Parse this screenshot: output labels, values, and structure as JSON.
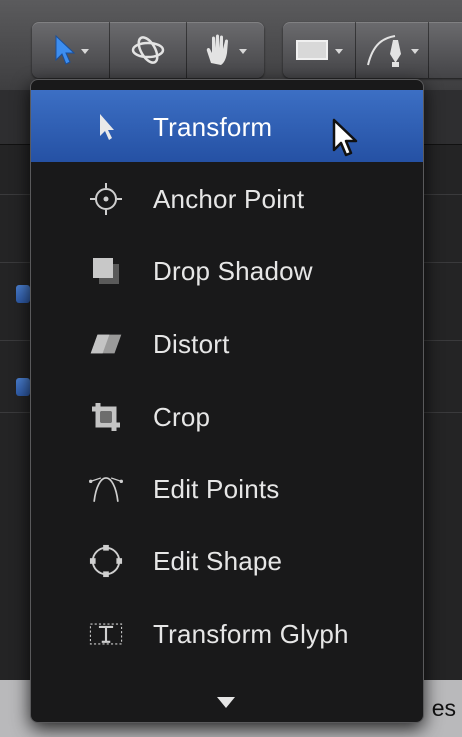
{
  "toolbar": {
    "groups": [
      {
        "name": "select-tools",
        "items": [
          "select-arrow-icon",
          "orbit-3d-icon",
          "hand-pan-icon"
        ]
      },
      {
        "name": "shape-tools",
        "items": [
          "rectangle-icon",
          "bezier-pen-icon"
        ]
      }
    ],
    "accent": "#3d8ef0"
  },
  "menu": {
    "items": [
      {
        "label": "Transform",
        "icon": "select-arrow-icon",
        "selected": true
      },
      {
        "label": "Anchor Point",
        "icon": "anchor-point-icon",
        "selected": false
      },
      {
        "label": "Drop Shadow",
        "icon": "drop-shadow-icon",
        "selected": false
      },
      {
        "label": "Distort",
        "icon": "distort-icon",
        "selected": false
      },
      {
        "label": "Crop",
        "icon": "crop-icon",
        "selected": false
      },
      {
        "label": "Edit Points",
        "icon": "edit-points-icon",
        "selected": false
      },
      {
        "label": "Edit Shape",
        "icon": "edit-shape-icon",
        "selected": false
      },
      {
        "label": "Transform Glyph",
        "icon": "transform-glyph-icon",
        "selected": false
      }
    ],
    "selected_color": "#2f62b8",
    "more_indicator": "scroll-down-arrow"
  },
  "background": {
    "partial_text": "es"
  }
}
